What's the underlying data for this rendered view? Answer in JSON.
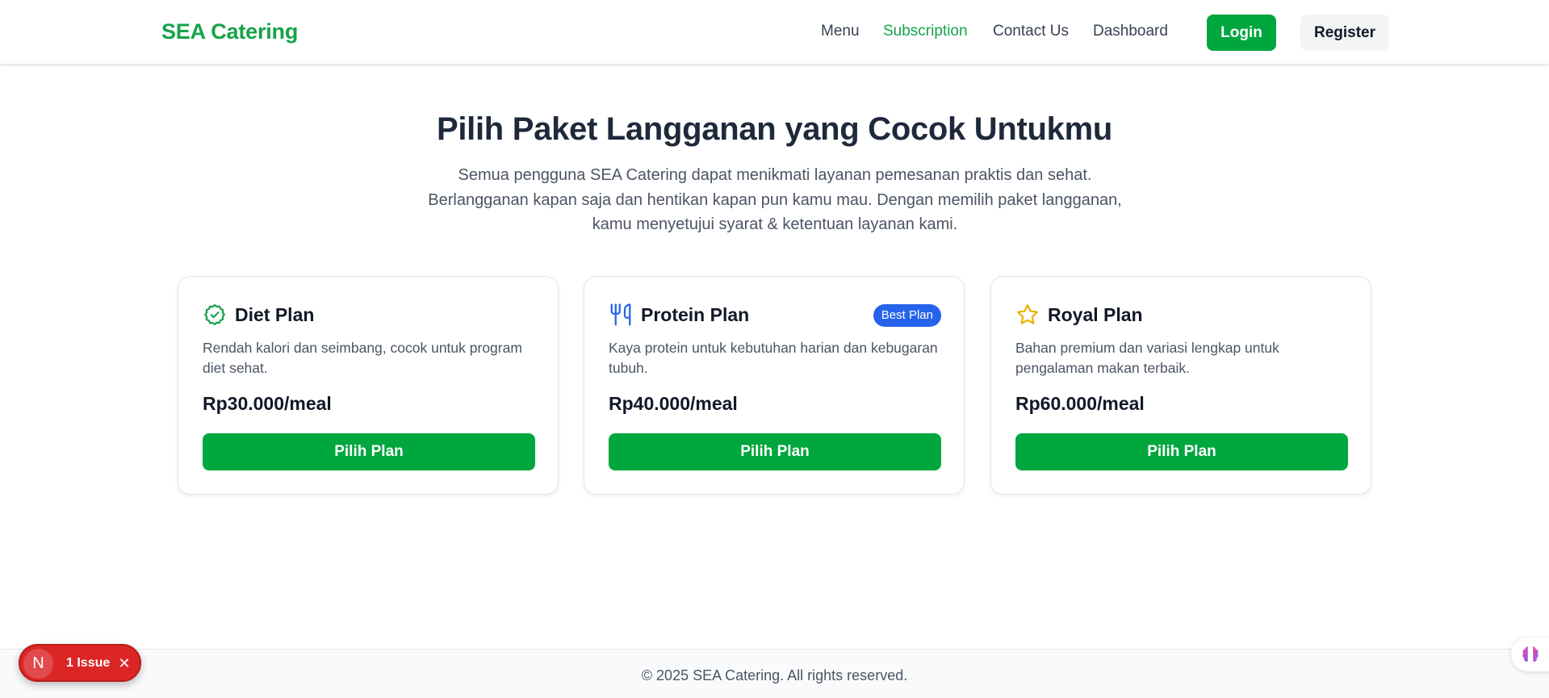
{
  "header": {
    "brand": "SEA Catering",
    "nav": [
      "Menu",
      "Subscription",
      "Contact Us",
      "Dashboard"
    ],
    "active_nav": "Subscription",
    "login_label": "Login",
    "register_label": "Register"
  },
  "hero": {
    "title": "Pilih Paket Langganan yang Cocok Untukmu",
    "description": "Semua pengguna SEA Catering dapat menikmati layanan pemesanan praktis dan sehat. Berlangganan kapan saja dan hentikan kapan pun kamu mau. Dengan memilih paket langganan, kamu menyetujui syarat & ketentuan layanan kami."
  },
  "plans": [
    {
      "icon": "badge-check-icon",
      "title": "Diet Plan",
      "description": "Rendah kalori dan seimbang, cocok untuk program diet sehat.",
      "price": "Rp30.000/meal",
      "button": "Pilih Plan"
    },
    {
      "icon": "utensils-icon",
      "title": "Protein Plan",
      "badge": "Best Plan",
      "description": "Kaya protein untuk kebutuhan harian dan kebugaran tubuh.",
      "price": "Rp40.000/meal",
      "button": "Pilih Plan"
    },
    {
      "icon": "star-icon",
      "title": "Royal Plan",
      "description": "Bahan premium dan variasi lengkap untuk pengalaman makan terbaik.",
      "price": "Rp60.000/meal",
      "button": "Pilih Plan"
    }
  ],
  "footer": {
    "text": "© 2025 SEA Catering. All rights reserved."
  },
  "dev_overlay": {
    "logo": "N",
    "issues_label": "1 Issue"
  },
  "colors": {
    "brand_green": "#16a34a",
    "button_green": "#00a63e",
    "badge_blue": "#2563eb",
    "icon_amber": "#eab308",
    "issue_red": "#dc2626"
  }
}
